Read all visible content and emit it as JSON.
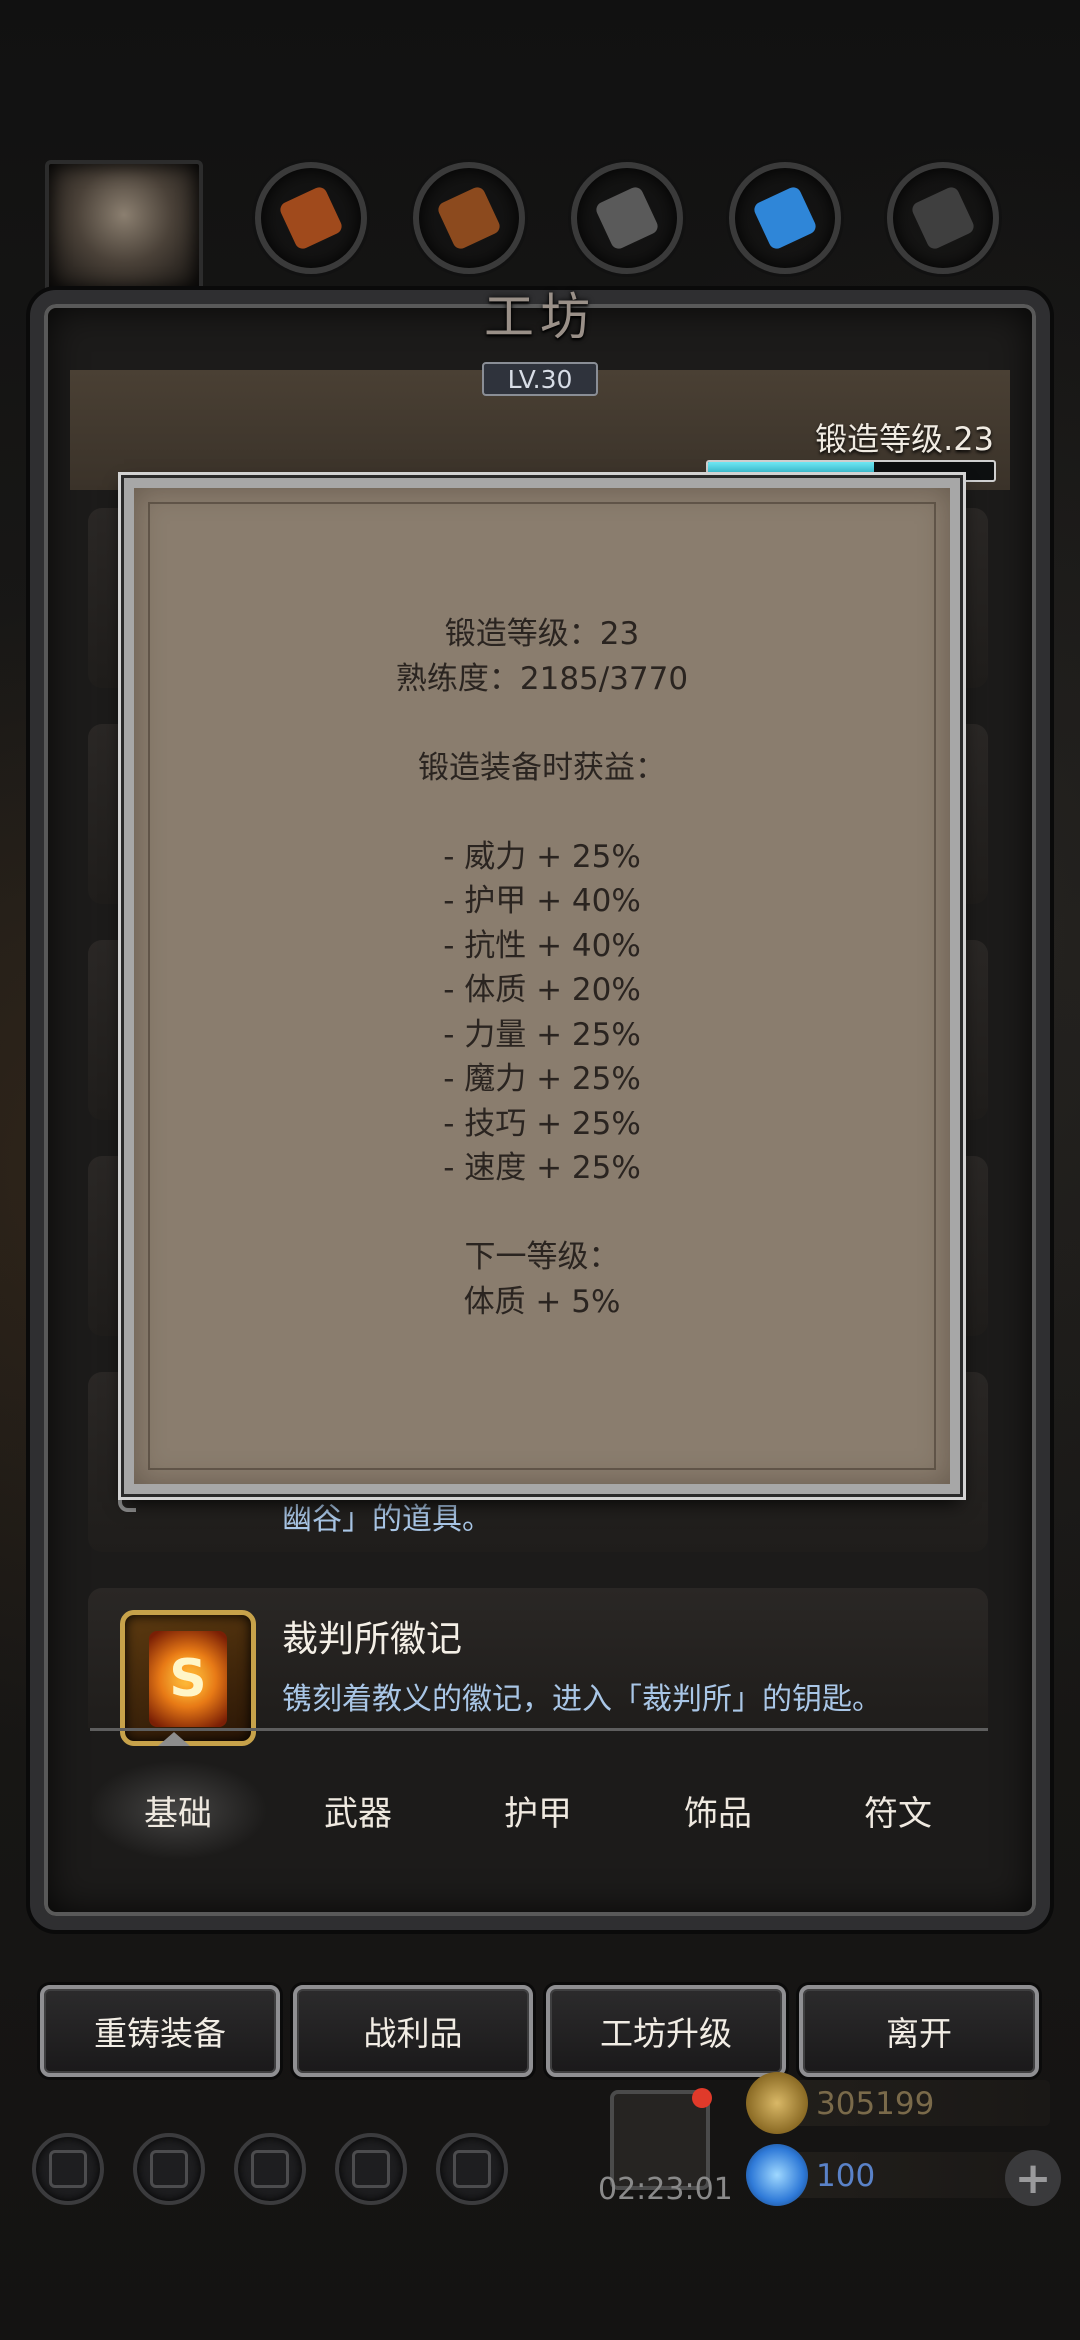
{
  "header": {
    "title": "工坊",
    "level": "LV.30",
    "forge_level_label": "锻造等级.23",
    "forge_progress": 0.58
  },
  "tools": [
    {
      "name": "hammer-tool-icon",
      "color": "#a04a1c"
    },
    {
      "name": "wood-tool-icon",
      "color": "#8c4a1e"
    },
    {
      "name": "iron-tool-icon",
      "color": "#5a5a5a"
    },
    {
      "name": "crystal-tool-icon",
      "color": "#2f86d8"
    },
    {
      "name": "steel-tool-icon",
      "color": "#3f3f3f"
    }
  ],
  "tooltip": {
    "lines": [
      "锻造等级：23",
      "熟练度：2185/3770",
      "",
      "锻造装备时获益：",
      "",
      "- 威力 + 25%",
      "- 护甲 + 40%",
      "- 抗性 + 40%",
      "- 体质 + 20%",
      "- 力量 + 25%",
      "- 魔力 + 25%",
      "- 技巧 + 25%",
      "- 速度 + 25%",
      "",
      "下一等级：",
      "体质 + 5%"
    ]
  },
  "list": {
    "partial_item": {
      "desc": "幽谷」的道具。"
    },
    "item": {
      "name": "裁判所徽记",
      "desc": "镌刻着教义的徽记，进入「裁判所」的钥匙。",
      "emblem_letter": "S"
    }
  },
  "tabs": [
    "基础",
    "武器",
    "护甲",
    "饰品",
    "符文"
  ],
  "buttons": [
    "重铸装备",
    "战利品",
    "工坊升级",
    "离开"
  ],
  "status": {
    "timer": "02:23:01",
    "gold": "305199",
    "gems": "100",
    "plus": "+"
  },
  "colors": {
    "accent_cyan": "#3fc8dc",
    "gold_text": "#7a6a4a",
    "gem_text": "#5a82c8",
    "item_desc": "#a9c6e6"
  }
}
